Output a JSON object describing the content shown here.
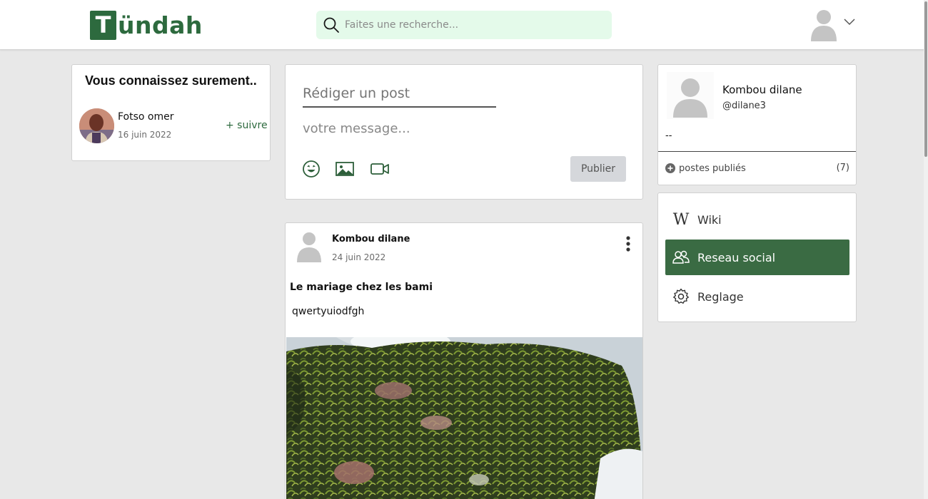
{
  "brand": {
    "logo_letter": "T",
    "logo_rest": "ündah",
    "color": "#2d6a3e"
  },
  "search": {
    "placeholder": "Faites une recherche..."
  },
  "suggestions": {
    "title": "Vous connaissez surement..",
    "items": [
      {
        "name": "Fotso omer",
        "date": "16 juin 2022",
        "follow_label": "+ suivre"
      }
    ]
  },
  "composer": {
    "title_placeholder": "Rédiger un post",
    "message_placeholder": "votre message...",
    "tools": [
      "emoji-icon",
      "image-icon",
      "video-icon"
    ],
    "publish_label": "Publier"
  },
  "post": {
    "author": "Kombou dilane",
    "date": "24 juin 2022",
    "title": "Le mariage chez les bami",
    "body": "qwertyuiodfgh"
  },
  "profile": {
    "name": "Kombou dilane",
    "handle": "@dilane3",
    "bio": "--",
    "posts_label": "postes publiés",
    "posts_count": "(7)"
  },
  "nav": {
    "items": [
      {
        "label": "Wiki",
        "icon": "wiki-icon",
        "active": false
      },
      {
        "label": "Reseau social",
        "icon": "people-icon",
        "active": true
      },
      {
        "label": "Reglage",
        "icon": "gear-icon",
        "active": false
      }
    ]
  },
  "colors": {
    "accent": "#2d6a3e",
    "nav_active": "#3a6b43",
    "search_bg": "#e4faea",
    "publish_bg": "#d5d7db"
  }
}
